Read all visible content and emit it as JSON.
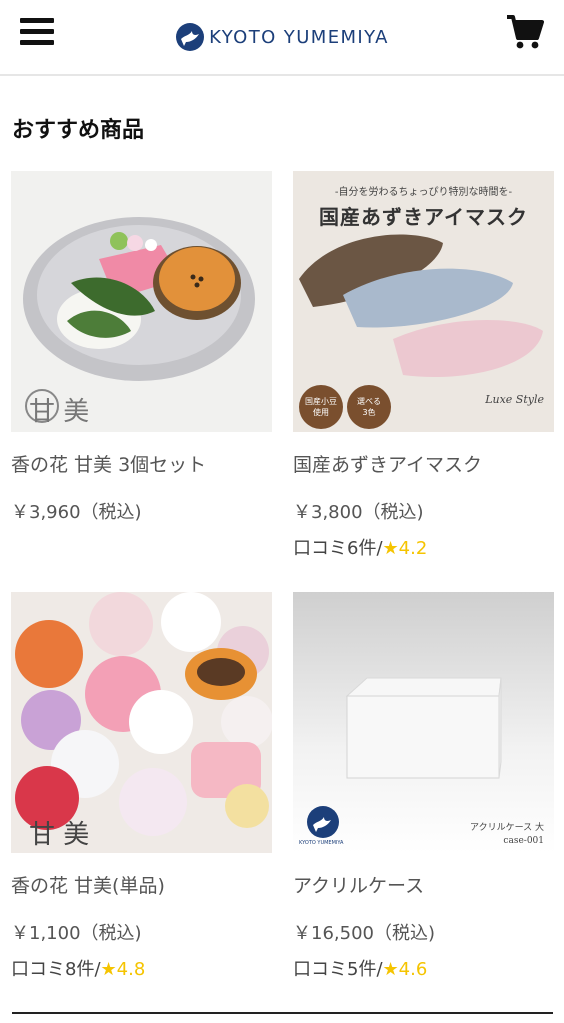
{
  "header": {
    "brand": "KYOTO YUMEMIYA",
    "menu_icon": "hamburger-icon",
    "cart_icon": "shopping-cart-icon",
    "brand_color": "#1c3f7a"
  },
  "section": {
    "title": "おすすめ商品"
  },
  "products": [
    {
      "name": "香の花 甘美 3個セット",
      "price": "￥3,960（税込)",
      "review_prefix": "",
      "rating": "",
      "image": {
        "logo_kanji_1": "甘",
        "logo_kanji_2": "美"
      }
    },
    {
      "name": "国産あずきアイマスク",
      "price": "￥3,800（税込)",
      "review_prefix": "口コミ6件/",
      "rating": "4.2",
      "image": {
        "banner_small": "-自分を労わるちょっぴり特別な時間を-",
        "banner_title": "国産あずきアイマスク",
        "badge_1_line1": "国産小豆",
        "badge_1_line2": "使用",
        "badge_2_line1": "選べる",
        "badge_2_line2": "3色",
        "signature": "Luxe Style"
      }
    },
    {
      "name": "香の花 甘美(単品)",
      "price": "￥1,100（税込)",
      "review_prefix": "口コミ8件/",
      "rating": "4.8",
      "image": {
        "logo_kanji_1": "甘",
        "logo_kanji_2": "美"
      }
    },
    {
      "name": "アクリルケース",
      "price": "￥16,500（税込)",
      "review_prefix": "口コミ5件/",
      "rating": "4.6",
      "image": {
        "brand_small": "KYOTO YUMEMIYA",
        "caption_jp": "アクリルケース 大",
        "caption_code": "case-001"
      }
    }
  ]
}
